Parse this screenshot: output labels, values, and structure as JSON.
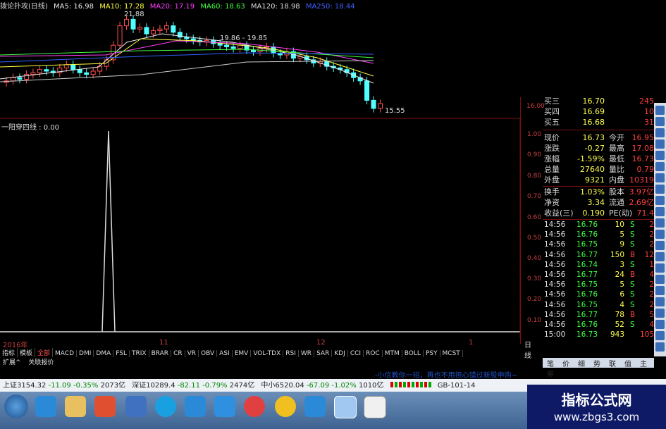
{
  "legend": {
    "name": "拨论扑攻(日线)",
    "ma5": "MA5: 16.98",
    "ma10": "MA10: 17.28",
    "ma20": "MA20: 17.19",
    "ma60": "MA60: 18.63",
    "ma120": "MA120: 18.98",
    "ma250": "MA250: 18.44"
  },
  "price_annotations": {
    "high": "21.88",
    "mid": "19.86 - 19.85",
    "low": "15.55"
  },
  "indicator_title": "一阳穿四线 : 0.00",
  "right_axis": {
    "price_label": "16.00",
    "ticks": [
      "1.00",
      "0.90",
      "0.80",
      "0.70",
      "0.60",
      "0.50",
      "0.40",
      "0.30",
      "0.20",
      "0.10"
    ]
  },
  "x_axis": {
    "labels": [
      "2016年",
      "11",
      "12",
      "1"
    ],
    "right": "日线"
  },
  "tabs": [
    "指标",
    "模板",
    "全部",
    "MACD",
    "DMI",
    "DMA",
    "FSL",
    "TRIX",
    "BRAR",
    "CR",
    "VR",
    "OBV",
    "ASI",
    "EMV",
    "VOL-TDX",
    "RSI",
    "WR",
    "SAR",
    "KDJ",
    "CCI",
    "ROC",
    "MTM",
    "BOLL",
    "PSY",
    "MCST"
  ],
  "tabs2": [
    "扩展^",
    "关联报价"
  ],
  "quote": {
    "bids": [
      {
        "label": "买三",
        "price": "16.70",
        "vol": "245"
      },
      {
        "label": "买四",
        "price": "16.69",
        "vol": "10"
      },
      {
        "label": "买五",
        "price": "16.68",
        "vol": "31"
      }
    ],
    "stats": [
      {
        "l1": "现价",
        "v1": "16.73",
        "l2": "今开",
        "v2": "16.95"
      },
      {
        "l1": "涨跌",
        "v1": "-0.27",
        "l2": "最高",
        "v2": "17.08"
      },
      {
        "l1": "涨幅",
        "v1": "-1.59%",
        "l2": "最低",
        "v2": "16.73"
      },
      {
        "l1": "总量",
        "v1": "27640",
        "l2": "量比",
        "v2": "0.79"
      },
      {
        "l1": "外盘",
        "v1": "9321",
        "l2": "内盘",
        "v2": "10319"
      }
    ],
    "stats2": [
      {
        "l1": "换手",
        "v1": "1.03%",
        "l2": "股本",
        "v2": "3.97亿"
      },
      {
        "l1": "净资",
        "v1": "3.34",
        "l2": "流通",
        "v2": "2.69亿"
      },
      {
        "l1": "收益(三)",
        "v1": "0.190",
        "l2": "PE(动)",
        "v2": "71.4"
      }
    ],
    "ticks": [
      {
        "t": "14:56",
        "p": "16.76",
        "v": "10",
        "s": "S",
        "n": "2"
      },
      {
        "t": "14:56",
        "p": "16.76",
        "v": "5",
        "s": "S",
        "n": "2"
      },
      {
        "t": "14:56",
        "p": "16.75",
        "v": "9",
        "s": "S",
        "n": "2"
      },
      {
        "t": "14:56",
        "p": "16.77",
        "v": "150",
        "s": "B",
        "n": "12"
      },
      {
        "t": "14:56",
        "p": "16.74",
        "v": "3",
        "s": "S",
        "n": "1"
      },
      {
        "t": "14:56",
        "p": "16.77",
        "v": "24",
        "s": "B",
        "n": "4"
      },
      {
        "t": "14:56",
        "p": "16.75",
        "v": "5",
        "s": "S",
        "n": "2"
      },
      {
        "t": "14:56",
        "p": "16.76",
        "v": "6",
        "s": "S",
        "n": "2"
      },
      {
        "t": "14:56",
        "p": "16.75",
        "v": "4",
        "s": "S",
        "n": "2"
      },
      {
        "t": "14:56",
        "p": "16.77",
        "v": "78",
        "s": "B",
        "n": "5"
      },
      {
        "t": "14:56",
        "p": "16.76",
        "v": "52",
        "s": "S",
        "n": "4"
      },
      {
        "t": "15:00",
        "p": "16.73",
        "v": "943",
        "s": "",
        "n": "105"
      }
    ]
  },
  "right_tabs": [
    "笔",
    "价",
    "细",
    "势",
    "联",
    "值",
    "主",
    "筹"
  ],
  "status": {
    "sh": "上证3154.32",
    "sh_chg": "-11.09",
    "sh_pct": "-0.35%",
    "sh_amt": "2073亿",
    "sz": "深证10289.4",
    "sz_chg": "-82.11",
    "sz_pct": "-0.79%",
    "sz_amt": "2474亿",
    "zx": "中小6520.04",
    "zx_chg": "-67.09",
    "zx_pct": "-1.02%",
    "zx_amt": "1010亿",
    "code": "GB-101-14"
  },
  "ad": "-小信教你一招，再也不用担心错过新股申购~",
  "watermark": {
    "line1": "指标公式网",
    "line2": "www.zbgs3.com"
  },
  "colors": {
    "ma5": "#e8e8e8",
    "ma10": "#ffff40",
    "ma20": "#ff40ff",
    "ma60": "#40ff40",
    "ma120": "#3060ff",
    "ma250": "#4060ff",
    "frame": "#7a1010"
  }
}
